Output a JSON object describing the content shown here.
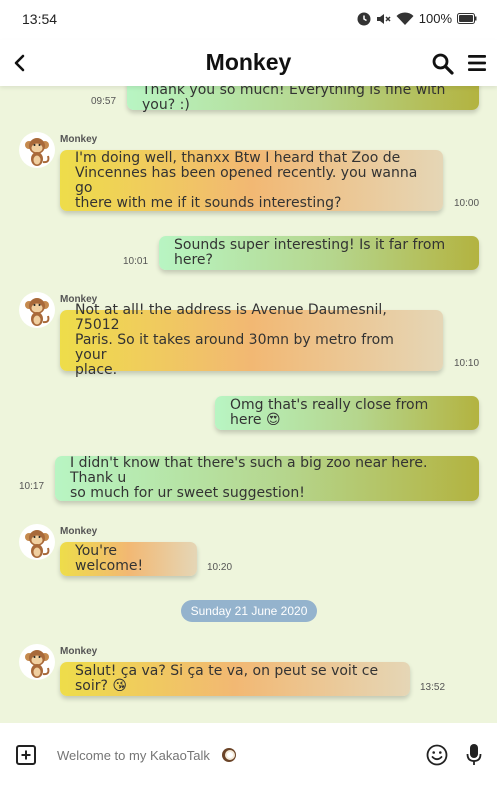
{
  "status": {
    "time": "13:54",
    "battery": "100%"
  },
  "header": {
    "title": "Monkey"
  },
  "input": {
    "placeholder": "Welcome to my KakaoTalk"
  },
  "date_divider": "Sunday 21 June 2020",
  "contact_name": "Monkey",
  "messages": [
    {
      "type": "sent",
      "lines": [
        "Thank you so much! Everything is fine with you? :)"
      ],
      "time": "09:57"
    },
    {
      "type": "received",
      "sender": "Monkey",
      "lines": [
        "I'm doing well, thanxx Btw I heard that Zoo de",
        "Vincennes has been opened recently. you wanna go",
        "there with me if it sounds interesting?"
      ],
      "time": "10:00"
    },
    {
      "type": "sent",
      "lines": [
        "Sounds super interesting! Is it far from here?"
      ],
      "time": "10:01"
    },
    {
      "type": "received",
      "sender": "Monkey",
      "lines": [
        "Not at all! the address is Avenue Daumesnil, 75012",
        "Paris. So it takes around 30mn by metro from your",
        "place."
      ],
      "time": "10:10"
    },
    {
      "type": "sent",
      "lines": [
        "Omg that's really close from here 😍"
      ],
      "time": ""
    },
    {
      "type": "sent",
      "lines": [
        "I didn't know that there's such a big zoo near here. Thank u",
        "so much for ur sweet suggestion!"
      ],
      "time": "10:17"
    },
    {
      "type": "received",
      "sender": "Monkey",
      "lines": [
        "You're welcome!"
      ],
      "time": "10:20"
    },
    {
      "type": "received",
      "sender": "Monkey",
      "lines": [
        "Salut! ça va? Si ça te va, on peut se voit ce soir? 😘"
      ],
      "time": "13:52"
    }
  ],
  "colors": {
    "chat_bg": "#eef5dc",
    "received_gradient": [
      "#eedd4a",
      "#f2b873",
      "#e5d6b6"
    ],
    "sent_gradient": [
      "#b8f5c3",
      "#b5d58c",
      "#b3b340"
    ],
    "date_chip": "#94b3cd"
  },
  "icons": [
    "back-icon",
    "search-icon",
    "menu-icon",
    "attach-icon",
    "coconut-icon",
    "emoji-icon",
    "mic-icon",
    "clock-icon",
    "mute-icon",
    "wifi-icon",
    "battery-icon",
    "monkey-avatar-icon"
  ]
}
